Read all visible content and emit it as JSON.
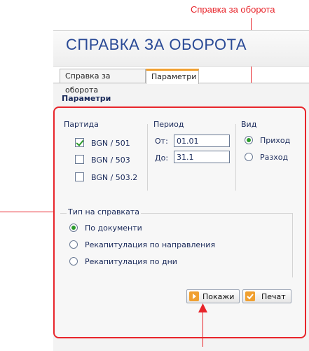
{
  "callout_top": "Справка за оборота",
  "header": {
    "title": "СПРАВКА ЗА ОБОРОТА"
  },
  "tabs": [
    {
      "label": "Справка за оборота"
    },
    {
      "label": "Параметри"
    }
  ],
  "section_title": "Параметри",
  "partida": {
    "label": "Партида",
    "items": [
      {
        "label": "BGN / 501",
        "checked": true
      },
      {
        "label": "BGN / 503",
        "checked": false
      },
      {
        "label": "BGN / 503.2",
        "checked": false
      }
    ]
  },
  "period": {
    "label": "Период",
    "from_label": "От:",
    "from_value": "01.01",
    "to_label": "До:",
    "to_value": "31.1"
  },
  "vid": {
    "label": "Вид",
    "options": [
      {
        "label": "Приход",
        "selected": true
      },
      {
        "label": "Разход",
        "selected": false
      }
    ]
  },
  "report_type": {
    "label": "Тип на справката",
    "options": [
      {
        "label": "По документи",
        "selected": true
      },
      {
        "label": "Рекапитулация по направления",
        "selected": false
      },
      {
        "label": "Рекапитулация по дни",
        "selected": false
      }
    ]
  },
  "buttons": {
    "show": "Покажи",
    "print": "Печат"
  },
  "colors": {
    "accent": "#e8252b",
    "title": "#2a4a96",
    "check": "#2a9a2a",
    "tab_highlight": "#f0a030"
  },
  "icons": {
    "show_icon": "arrow-right-icon",
    "print_icon": "checkmark-icon"
  }
}
